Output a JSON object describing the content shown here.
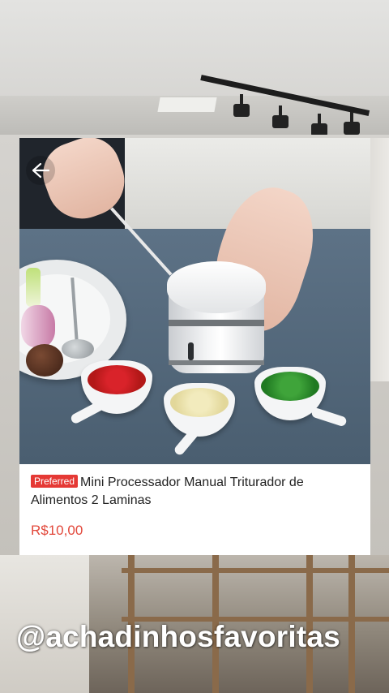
{
  "product": {
    "badge": "Preferred",
    "title": "Mini Processador Manual Triturador de Alimentos 2 Laminas",
    "price": "R$10,00"
  },
  "overlay": {
    "handle": "@achadinhosfavoritas"
  },
  "icons": {
    "back": "back-arrow-icon"
  },
  "colors": {
    "badge_bg": "#e53935",
    "price": "#e2483b",
    "card_bg": "#ffffff"
  }
}
